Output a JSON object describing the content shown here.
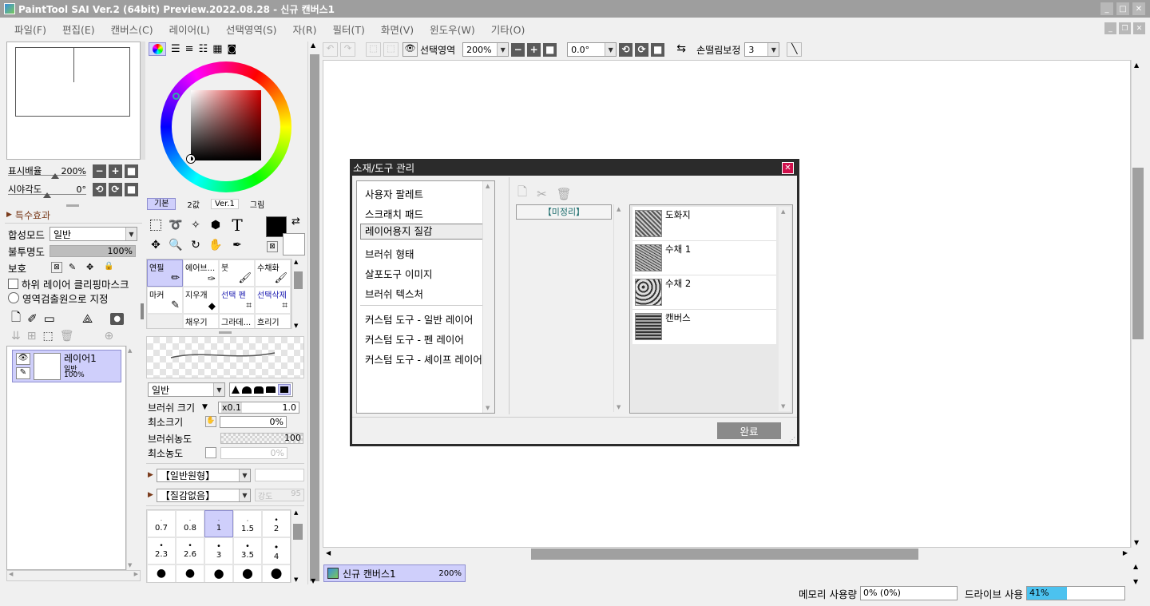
{
  "window": {
    "title": "PaintTool SAI Ver.2 (64bit) Preview.2022.08.28 - 신규 캔버스1"
  },
  "menu": [
    "파일(F)",
    "편집(E)",
    "캔버스(C)",
    "레이어(L)",
    "선택영역(S)",
    "자(R)",
    "필터(T)",
    "화면(V)",
    "윈도우(W)",
    "기타(O)"
  ],
  "navigator": {
    "zoom_label": "표시배율",
    "zoom_value": "200%",
    "angle_label": "시야각도",
    "angle_value": "0°"
  },
  "effects": {
    "label": "특수효과"
  },
  "layer_props": {
    "blend_label": "합성모드",
    "blend_value": "일반",
    "opacity_label": "불투명도",
    "opacity_value": "100%",
    "opacity": 1.0,
    "protect_label": "보호",
    "clip_label": "하위 레이어 클리핑마스크",
    "select_src_label": "영역검출원으로 지정"
  },
  "layer": {
    "name": "레이어1",
    "mode": "일반",
    "opacity": "100%"
  },
  "color_tabs": [
    "기본",
    "2값",
    "Ver.1",
    "그림"
  ],
  "brushes": [
    {
      "name": "연필",
      "selected": true
    },
    {
      "name": "에어브...",
      "selected": false
    },
    {
      "name": "붓",
      "selected": false
    },
    {
      "name": "수채화",
      "selected": false
    },
    {
      "name": "마커",
      "selected": false
    },
    {
      "name": "지우개",
      "selected": false
    },
    {
      "name": "선택 펜",
      "selected": false
    },
    {
      "name": "선택삭제",
      "selected": false
    },
    {
      "name": "",
      "selected": false
    },
    {
      "name": "채우기",
      "selected": false
    },
    {
      "name": "그라데...",
      "selected": false
    },
    {
      "name": "흐리기",
      "selected": false
    }
  ],
  "brush_settings": {
    "mode_value": "일반",
    "size_label": "브러쉬 크기",
    "size_mult": "x0.1",
    "size_value": "1.0",
    "min_size_label": "최소크기",
    "min_size_value": "0%",
    "density_label": "브러쉬농도",
    "density_value": "100",
    "min_density_label": "최소농도",
    "min_density_value": "0%",
    "shape_value": "【일반원형】",
    "texture_value": "【질감없음】",
    "strength_label": "강도",
    "strength_value": "95"
  },
  "sizes": [
    "0.7",
    "0.8",
    "1",
    "1.5",
    "2",
    "2.3",
    "2.6",
    "3",
    "3.5",
    "4"
  ],
  "toolbar": {
    "selection_label": "선택영역",
    "zoom_value": "200%",
    "angle_value": "0.0°",
    "stabilizer_label": "손떨림보정",
    "stabilizer_value": "3"
  },
  "dialog": {
    "title": "소재/도구 관리",
    "categories": [
      "사용자 팔레트",
      "스크래치 패드",
      "레이어용지 질감",
      "브러쉬 형태",
      "살포도구 이미지",
      "브러쉬 텍스처",
      "커스텀 도구 - 일반 레이어",
      "커스텀 도구 - 펜 레이어",
      "커스텀 도구 - 셰이프 레이어"
    ],
    "selected_category": "레이어용지 질감",
    "folder_label": "【미정리】",
    "textures": [
      "도화지",
      "수채 1",
      "수채 2",
      "캔버스"
    ],
    "done_label": "완료"
  },
  "canvas_tab": {
    "name": "신규 캔버스1",
    "zoom": "200%"
  },
  "status": {
    "memory_label": "메모리 사용량",
    "memory_value": "0% (0%)",
    "drive_label": "드라이브 사용",
    "drive_value": "41%",
    "drive_fraction": 0.41
  },
  "colors": {
    "accent": "#cfcffb",
    "accent_border": "#8e8ed0",
    "title_bar": "#2b2b2b",
    "close_red": "#d0104c"
  }
}
